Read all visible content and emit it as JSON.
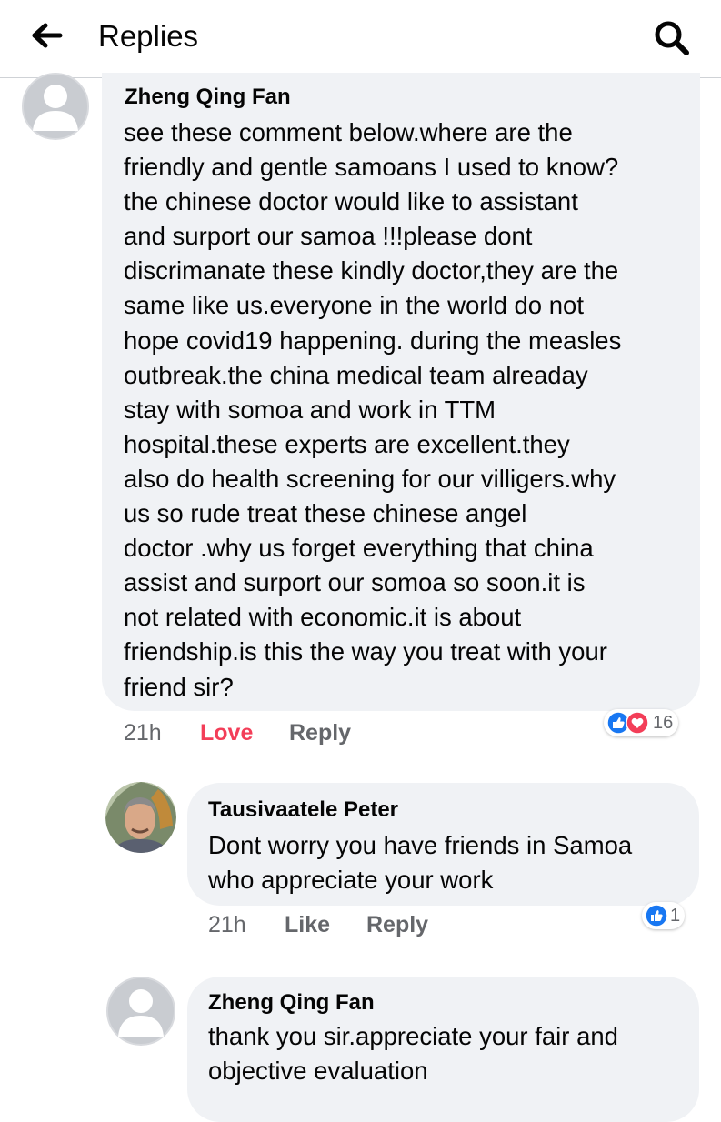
{
  "header": {
    "title": "Replies",
    "back_icon": "arrow-left-icon",
    "search_icon": "search-icon"
  },
  "comments": [
    {
      "author": "Zheng Qing Fan",
      "lines": [
        "see these comment below.where are the",
        "friendly and gentle samoans I used to know?",
        "the chinese doctor would like to assistant",
        "and surport our samoa !!!please dont",
        "discrimanate these kindly doctor,they are the",
        "same like us.everyone in the world do not",
        "hope covid19 happening. during the measles",
        "outbreak.the china medical team alreaday",
        "stay with somoa and work in TTM",
        "hospital.these experts are excellent.they",
        "also do health screening for our villigers.why",
        "us so rude treat these chinese angel",
        "doctor .why us forget everything that china",
        "assist and surport our somoa so soon.it is",
        "not related with economic.it is about",
        "friendship.is this the way you treat with your",
        "friend sir?"
      ],
      "time": "21h",
      "like_label": "Love",
      "reply_label": "Reply",
      "reaction_count": "16",
      "reactions": [
        "like-icon",
        "love-icon"
      ]
    },
    {
      "author": "Tausivaatele Peter",
      "lines": [
        "Dont worry you have friends in Samoa",
        "who appreciate your work"
      ],
      "time": "21h",
      "like_label": "Like",
      "reply_label": "Reply",
      "reaction_count": "1",
      "reactions": [
        "like-icon"
      ]
    },
    {
      "author": "Zheng Qing Fan",
      "lines": [
        "thank you sir.appreciate your fair and",
        "objective evaluation"
      ]
    }
  ],
  "colors": {
    "love": "#f33e58",
    "like": "#1877f2",
    "bubble": "#f0f2f5",
    "meta": "#65676b"
  }
}
